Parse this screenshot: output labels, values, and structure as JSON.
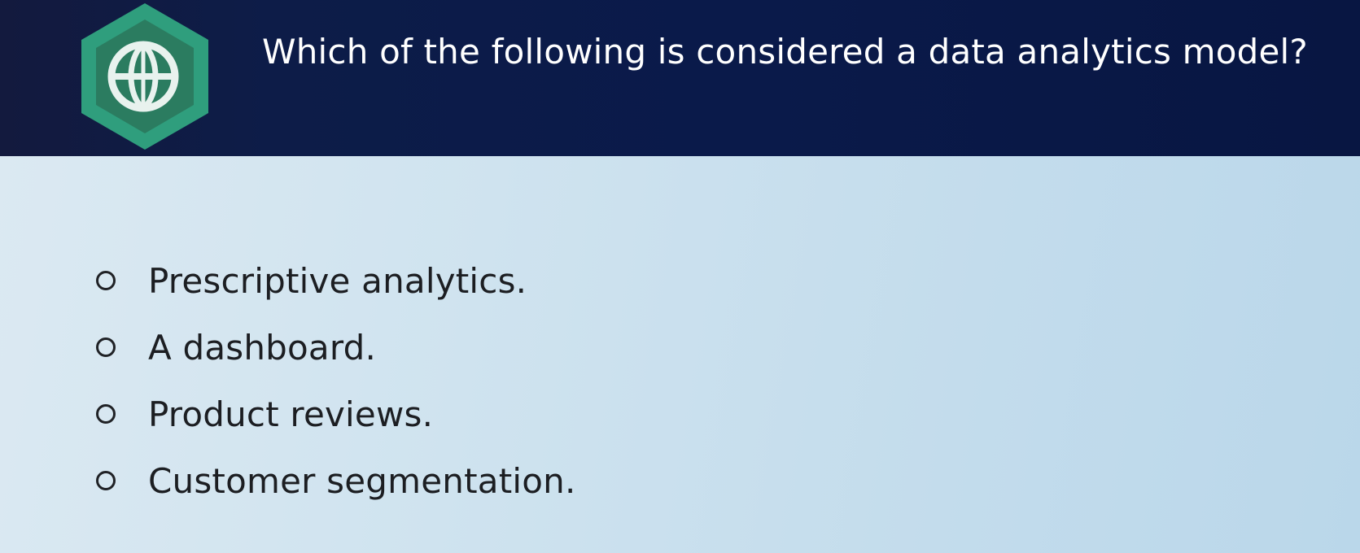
{
  "header": {
    "question": "Which of the following is considered a data analytics model?",
    "badge_icon": "globe-icon",
    "colors": {
      "banner": "#0a1a4a",
      "badge_outer": "#2e9e7c",
      "badge_inner": "#2f7b60"
    }
  },
  "options": [
    {
      "label": "Prescriptive analytics.",
      "selected": false
    },
    {
      "label": "A dashboard.",
      "selected": false
    },
    {
      "label": "Product reviews.",
      "selected": false
    },
    {
      "label": "Customer segmentation.",
      "selected": false
    }
  ]
}
